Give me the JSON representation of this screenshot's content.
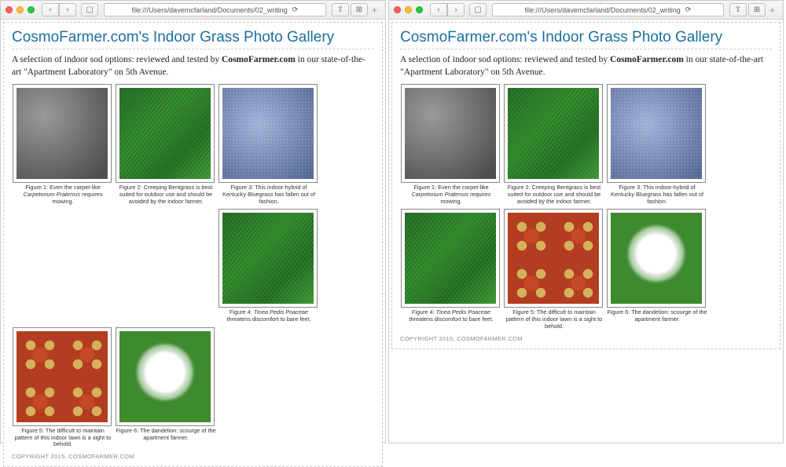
{
  "browser": {
    "url": "file:///Users/davemcfarland/Documents/02_writing",
    "back": "‹",
    "forward": "›",
    "sidebar": "▢",
    "share": "⇪",
    "tabs": "⊞",
    "reload": "⟳",
    "plus": "+"
  },
  "page": {
    "title": "CosmoFarmer.com's Indoor Grass Photo Gallery",
    "intro_pre": "A selection of indoor sod options: reviewed and tested by ",
    "intro_strong": "CosmoFarmer.com",
    "intro_post": " in our state-of-the-art \"Apartment Laboratory\" on 5th Avenue.",
    "copyright": "COPYRIGHT 2015, COSMOFARMER.COM"
  },
  "figures": [
    {
      "n": "1",
      "pre": "Figure 1: Even the carpet-like ",
      "em": "Carpetorium Pratensis",
      "post": " requires mowing.",
      "tex": "tex-gray"
    },
    {
      "n": "2",
      "pre": "Figure 2: Creeping Bentgrass is best suited for outdoor use and should be avoided by the indoor farmer.",
      "em": "",
      "post": "",
      "tex": "tex-grass"
    },
    {
      "n": "3",
      "pre": "Figure 3: This indoor-hybrid of Kentucky Bluegrass has fallen out of fashion.",
      "em": "",
      "post": "",
      "tex": "tex-blue"
    },
    {
      "n": "4",
      "pre": "Figure 4: ",
      "em": "Tinea Pedis Poaceae",
      "post": " threatens discomfort to bare feet.",
      "tex": "tex-grass"
    },
    {
      "n": "5",
      "pre": "Figure 5: The difficult to maintain pattern of this indoor lawn is a sight to behold.",
      "em": "",
      "post": "",
      "tex": "tex-rug"
    },
    {
      "n": "6",
      "pre": "Figure 6: The dandelion: scourge of the apartment farmer.",
      "em": "",
      "post": "",
      "tex": "tex-dandelion"
    }
  ]
}
